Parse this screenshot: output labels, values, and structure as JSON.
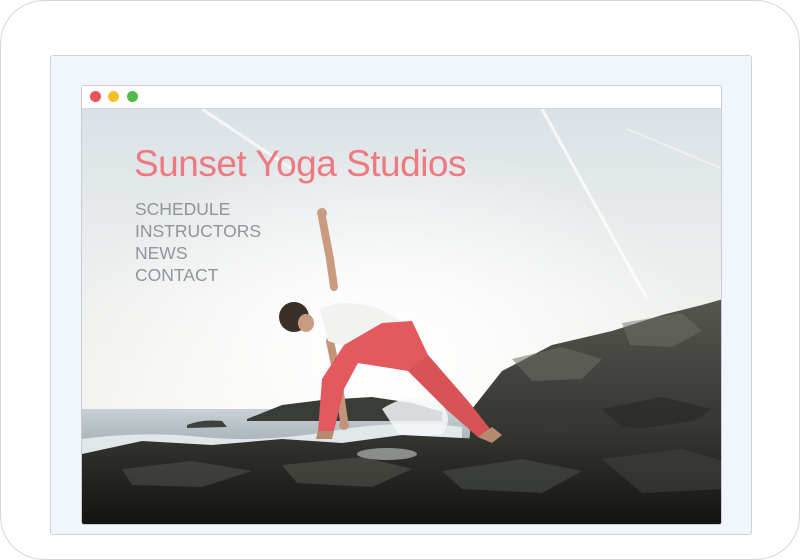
{
  "window": {
    "controls": [
      {
        "name": "close",
        "color": "#e9535a"
      },
      {
        "name": "minimize",
        "color": "#f3c127"
      },
      {
        "name": "maximize",
        "color": "#4fbc4b"
      }
    ]
  },
  "site": {
    "title": "Sunset Yoga Studios",
    "title_color": "#ee7a80",
    "nav_color": "#8f959d",
    "nav": [
      {
        "label": "SCHEDULE"
      },
      {
        "label": "INSTRUCTORS"
      },
      {
        "label": "NEWS"
      },
      {
        "label": "CONTACT"
      }
    ]
  },
  "hero_image": {
    "icon": "yoga-pose-photo",
    "accent_pants": "#e25a5e"
  }
}
